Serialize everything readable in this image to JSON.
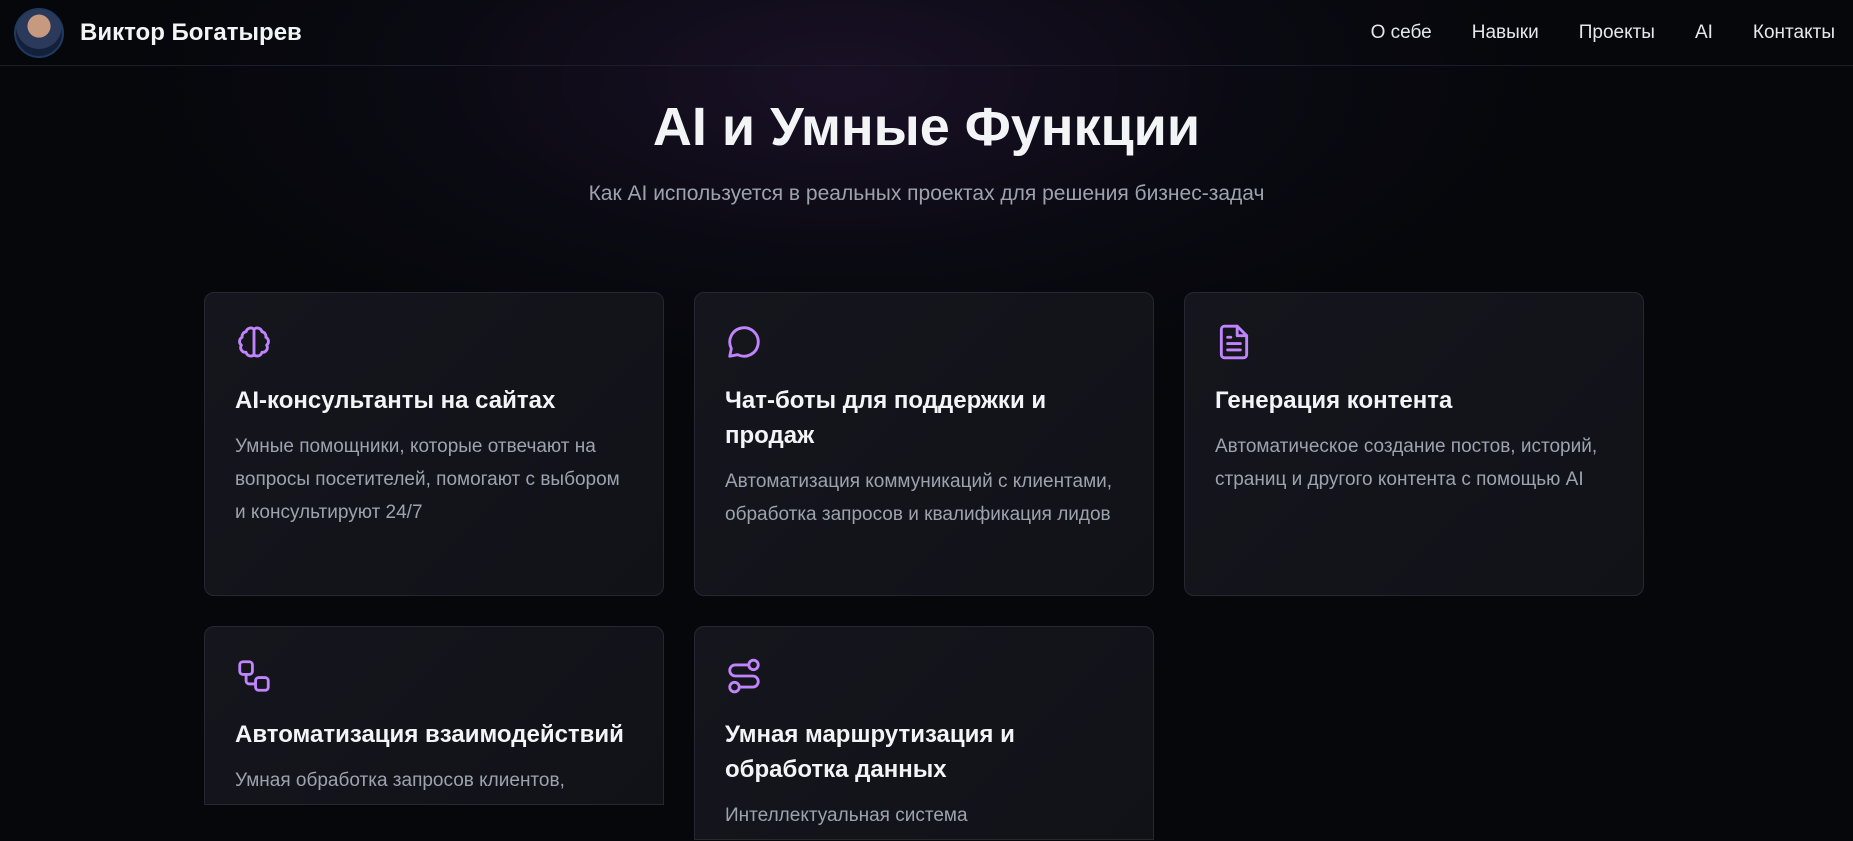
{
  "header": {
    "name": "Виктор Богатырев",
    "nav": [
      "О себе",
      "Навыки",
      "Проекты",
      "AI",
      "Контакты"
    ]
  },
  "section": {
    "title": "AI и Умные Функции",
    "subtitle": "Как AI используется в реальных проектах для решения бизнес-задач"
  },
  "accent": "#c084fc",
  "cards": [
    {
      "icon": "brain-icon",
      "title": "AI-консультанты на сайтах",
      "desc": "Умные помощники, которые отвечают на вопросы посетителей, помогают с выбором и консультируют 24/7"
    },
    {
      "icon": "chat-bubble-icon",
      "title": "Чат-боты для поддержки и продаж",
      "desc": "Автоматизация коммуникаций с клиентами, обработка запросов и квалификация лидов"
    },
    {
      "icon": "document-icon",
      "title": "Генерация контента",
      "desc": "Автоматическое создание постов, историй, страниц и другого контента с помощью AI"
    },
    {
      "icon": "workflow-icon",
      "title": "Автоматизация взаимодействий",
      "desc": "Умная обработка запросов клиентов,"
    },
    {
      "icon": "route-icon",
      "title": "Умная маршрутизация и обработка данных",
      "desc": "Интеллектуальная система"
    }
  ]
}
